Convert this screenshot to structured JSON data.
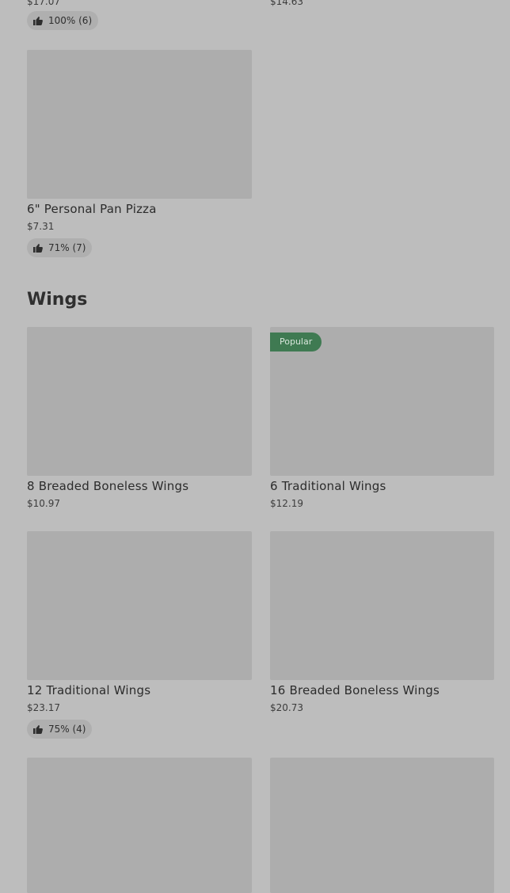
{
  "top_partial": {
    "left_price": "$17.07",
    "left_rating": "100% (6)",
    "right_price": "$14.63"
  },
  "pizza_items": [
    {
      "name": "6\" Personal Pan Pizza",
      "price": "$7.31",
      "rating": "71% (7)"
    }
  ],
  "wings_section": {
    "title": "Wings",
    "items": [
      {
        "name": "8 Breaded Boneless Wings",
        "price": "$10.97"
      },
      {
        "name": "6 Traditional Wings",
        "price": "$12.19",
        "badge": "Popular"
      },
      {
        "name": "12 Traditional Wings",
        "price": "$23.17",
        "rating": "75% (4)"
      },
      {
        "name": "16 Breaded Boneless Wings",
        "price": "$20.73"
      }
    ]
  },
  "icons": {
    "thumbs_up": "thumbs-up-icon"
  }
}
